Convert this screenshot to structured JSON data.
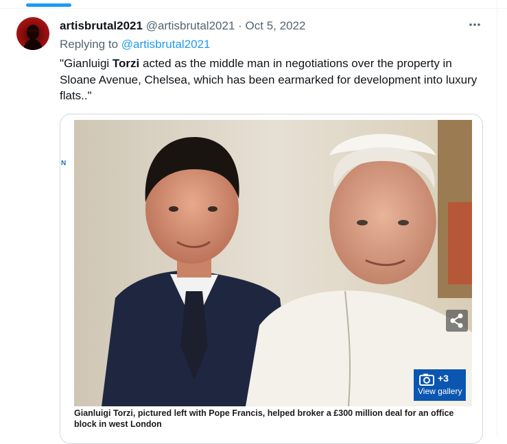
{
  "tweet": {
    "display_name": "artisbrutal2021",
    "handle": "@artisbrutal2021",
    "separator": "·",
    "date": "Oct 5, 2022",
    "more_icon": "ellipsis-icon",
    "replying_prefix": "Replying to",
    "replying_to": "@artisbrutal2021",
    "text_before": "\"Gianluigi ",
    "text_bold": "Torzi",
    "text_after": " acted as the middle man in negotiations over the property in Sloane Avenue, Chelsea, which has been earmarked for development into luxury flats..\""
  },
  "card": {
    "edge_text": "N",
    "share_icon": "share-icon",
    "gallery": {
      "camera_icon": "camera-icon",
      "count": "+3",
      "label": "View gallery"
    },
    "caption": "Gianluigi Torzi, pictured left with Pope Francis, helped broker a £300 million deal for an office block in west London"
  },
  "colors": {
    "accent": "#1d9bf0",
    "secondary_text": "#536471",
    "gallery_blue": "#0a56b0"
  }
}
